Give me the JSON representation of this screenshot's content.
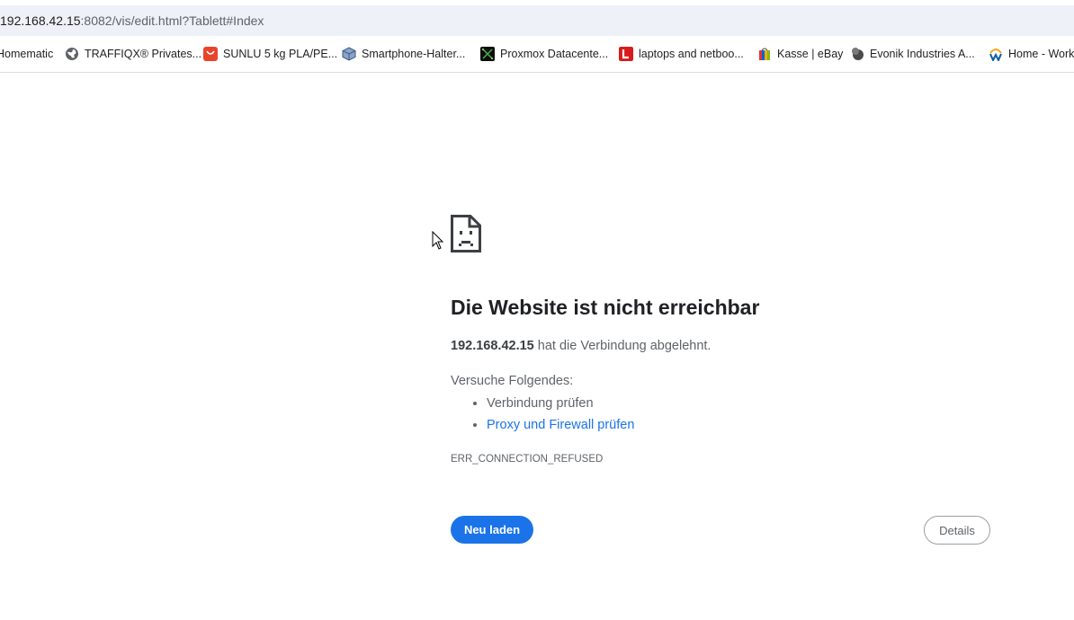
{
  "address_bar": {
    "host": "192.168.42.15",
    "rest": ":8082/vis/edit.html?Tablett#Index"
  },
  "bookmarks": [
    {
      "label": "Homematic",
      "icon": "homematic-icon"
    },
    {
      "label": "TRAFFIQX® Privates...",
      "icon": "globe-icon"
    },
    {
      "label": "SUNLU 5 kg PLA/PE...",
      "icon": "aliexpress-icon"
    },
    {
      "label": "Smartphone-Halter...",
      "icon": "cube-icon"
    },
    {
      "label": "Proxmox Datacente...",
      "icon": "proxmox-icon"
    },
    {
      "label": "laptops and netboo...",
      "icon": "l-logo-icon"
    },
    {
      "label": "Kasse | eBay",
      "icon": "ebay-bag-icon"
    },
    {
      "label": "Evonik Industries A...",
      "icon": "evonik-icon"
    },
    {
      "label": "Home - Workday",
      "icon": "workday-icon"
    }
  ],
  "error": {
    "title": "Die Website ist nicht erreichbar",
    "host": "192.168.42.15",
    "message": " hat die Verbindung abgelehnt.",
    "try_label": "Versuche Folgendes:",
    "suggestion_1": "Verbindung prüfen",
    "suggestion_2": "Proxy und Firewall prüfen",
    "code": "ERR_CONNECTION_REFUSED"
  },
  "buttons": {
    "reload": "Neu laden",
    "details": "Details"
  },
  "colors": {
    "accent": "#1a73e8",
    "address_bar_bg": "#eef1f7"
  }
}
